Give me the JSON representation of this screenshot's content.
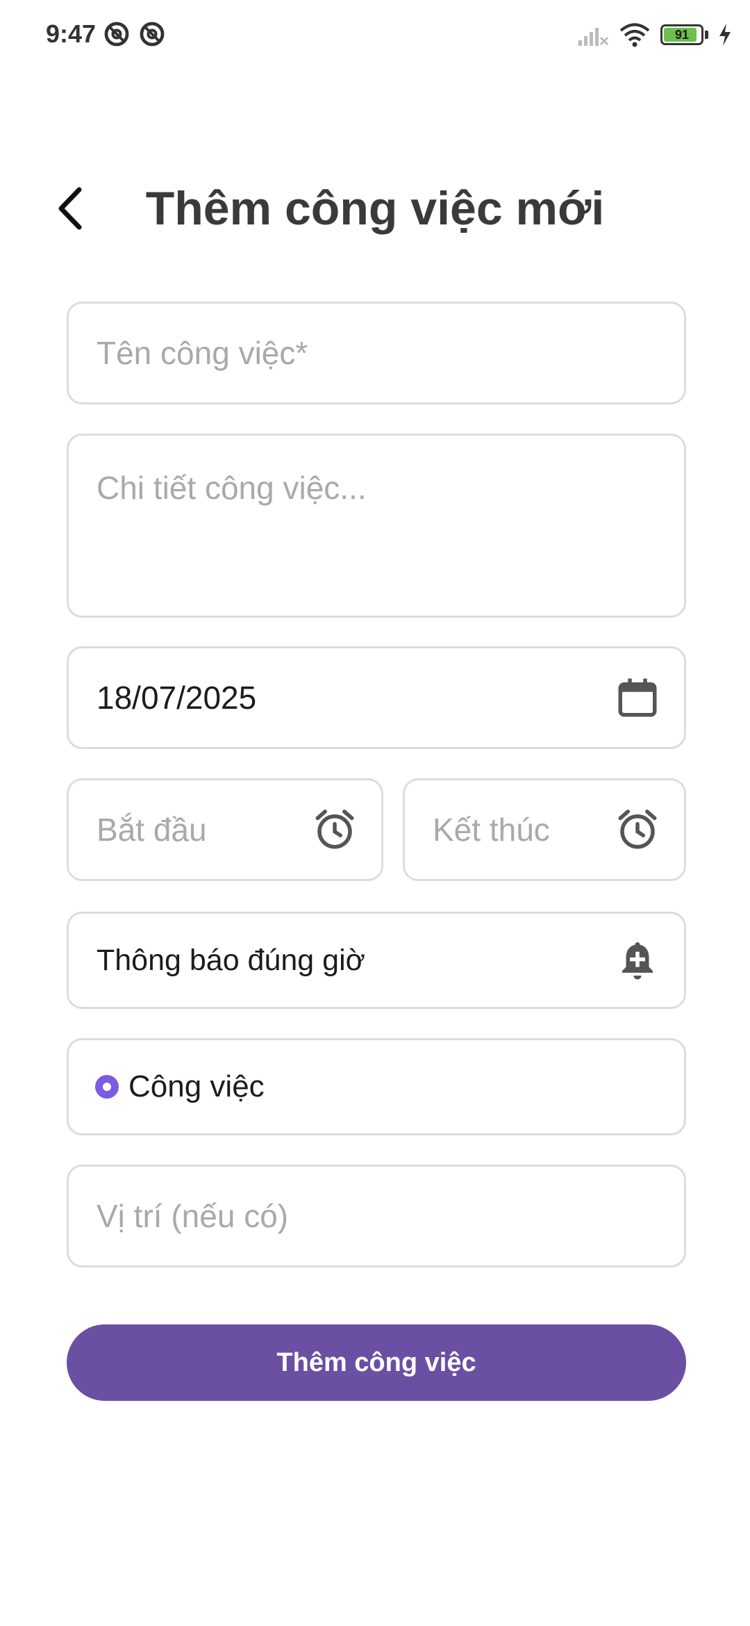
{
  "status_bar": {
    "time": "9:47",
    "battery_level": "91",
    "battery_fraction": 0.91,
    "icons": [
      "dnd-icon",
      "dnd-icon",
      "signal-icon",
      "wifi-icon",
      "battery-icon",
      "charging-icon"
    ]
  },
  "header": {
    "title": "Thêm công việc mới",
    "back_icon": "back-arrow-icon"
  },
  "form": {
    "name_placeholder": "Tên công việc*",
    "detail_placeholder": "Chi tiết công việc...",
    "date_value": "18/07/2025",
    "date_icon": "calendar-icon",
    "start_placeholder": "Bắt đầu",
    "end_placeholder": "Kết thúc",
    "time_icon": "alarm-icon",
    "notify_value": "Thông báo đúng giờ",
    "notify_icon": "bell-plus-icon",
    "type_value": "Công việc",
    "location_placeholder": "Vị trí (nếu có)"
  },
  "submit": {
    "label": "Thêm công việc"
  },
  "colors": {
    "accent": "#6a4fa3",
    "radio": "#7b5ce0",
    "border": "#dcdcdc",
    "placeholder": "#a9a9a9"
  }
}
